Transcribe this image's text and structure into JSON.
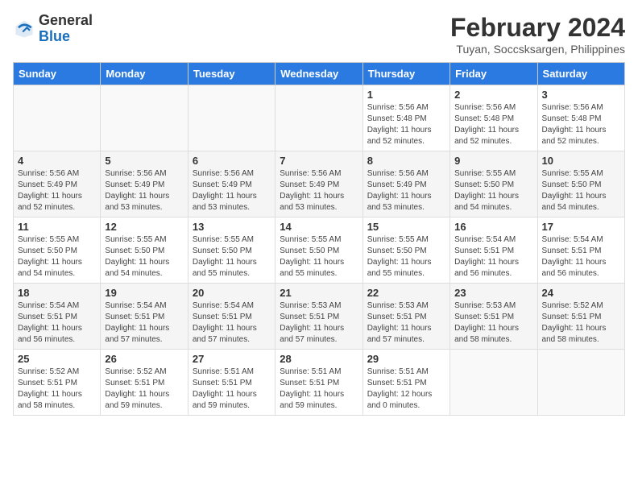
{
  "header": {
    "logo_line1": "General",
    "logo_line2": "Blue",
    "month_title": "February 2024",
    "subtitle": "Tuyan, Soccsksargen, Philippines"
  },
  "weekdays": [
    "Sunday",
    "Monday",
    "Tuesday",
    "Wednesday",
    "Thursday",
    "Friday",
    "Saturday"
  ],
  "weeks": [
    [
      {
        "day": "",
        "sunrise": "",
        "sunset": "",
        "daylight": ""
      },
      {
        "day": "",
        "sunrise": "",
        "sunset": "",
        "daylight": ""
      },
      {
        "day": "",
        "sunrise": "",
        "sunset": "",
        "daylight": ""
      },
      {
        "day": "",
        "sunrise": "",
        "sunset": "",
        "daylight": ""
      },
      {
        "day": "1",
        "sunrise": "5:56 AM",
        "sunset": "5:48 PM",
        "daylight": "11 hours and 52 minutes."
      },
      {
        "day": "2",
        "sunrise": "5:56 AM",
        "sunset": "5:48 PM",
        "daylight": "11 hours and 52 minutes."
      },
      {
        "day": "3",
        "sunrise": "5:56 AM",
        "sunset": "5:48 PM",
        "daylight": "11 hours and 52 minutes."
      }
    ],
    [
      {
        "day": "4",
        "sunrise": "5:56 AM",
        "sunset": "5:49 PM",
        "daylight": "11 hours and 52 minutes."
      },
      {
        "day": "5",
        "sunrise": "5:56 AM",
        "sunset": "5:49 PM",
        "daylight": "11 hours and 53 minutes."
      },
      {
        "day": "6",
        "sunrise": "5:56 AM",
        "sunset": "5:49 PM",
        "daylight": "11 hours and 53 minutes."
      },
      {
        "day": "7",
        "sunrise": "5:56 AM",
        "sunset": "5:49 PM",
        "daylight": "11 hours and 53 minutes."
      },
      {
        "day": "8",
        "sunrise": "5:56 AM",
        "sunset": "5:49 PM",
        "daylight": "11 hours and 53 minutes."
      },
      {
        "day": "9",
        "sunrise": "5:55 AM",
        "sunset": "5:50 PM",
        "daylight": "11 hours and 54 minutes."
      },
      {
        "day": "10",
        "sunrise": "5:55 AM",
        "sunset": "5:50 PM",
        "daylight": "11 hours and 54 minutes."
      }
    ],
    [
      {
        "day": "11",
        "sunrise": "5:55 AM",
        "sunset": "5:50 PM",
        "daylight": "11 hours and 54 minutes."
      },
      {
        "day": "12",
        "sunrise": "5:55 AM",
        "sunset": "5:50 PM",
        "daylight": "11 hours and 54 minutes."
      },
      {
        "day": "13",
        "sunrise": "5:55 AM",
        "sunset": "5:50 PM",
        "daylight": "11 hours and 55 minutes."
      },
      {
        "day": "14",
        "sunrise": "5:55 AM",
        "sunset": "5:50 PM",
        "daylight": "11 hours and 55 minutes."
      },
      {
        "day": "15",
        "sunrise": "5:55 AM",
        "sunset": "5:50 PM",
        "daylight": "11 hours and 55 minutes."
      },
      {
        "day": "16",
        "sunrise": "5:54 AM",
        "sunset": "5:51 PM",
        "daylight": "11 hours and 56 minutes."
      },
      {
        "day": "17",
        "sunrise": "5:54 AM",
        "sunset": "5:51 PM",
        "daylight": "11 hours and 56 minutes."
      }
    ],
    [
      {
        "day": "18",
        "sunrise": "5:54 AM",
        "sunset": "5:51 PM",
        "daylight": "11 hours and 56 minutes."
      },
      {
        "day": "19",
        "sunrise": "5:54 AM",
        "sunset": "5:51 PM",
        "daylight": "11 hours and 57 minutes."
      },
      {
        "day": "20",
        "sunrise": "5:54 AM",
        "sunset": "5:51 PM",
        "daylight": "11 hours and 57 minutes."
      },
      {
        "day": "21",
        "sunrise": "5:53 AM",
        "sunset": "5:51 PM",
        "daylight": "11 hours and 57 minutes."
      },
      {
        "day": "22",
        "sunrise": "5:53 AM",
        "sunset": "5:51 PM",
        "daylight": "11 hours and 57 minutes."
      },
      {
        "day": "23",
        "sunrise": "5:53 AM",
        "sunset": "5:51 PM",
        "daylight": "11 hours and 58 minutes."
      },
      {
        "day": "24",
        "sunrise": "5:52 AM",
        "sunset": "5:51 PM",
        "daylight": "11 hours and 58 minutes."
      }
    ],
    [
      {
        "day": "25",
        "sunrise": "5:52 AM",
        "sunset": "5:51 PM",
        "daylight": "11 hours and 58 minutes."
      },
      {
        "day": "26",
        "sunrise": "5:52 AM",
        "sunset": "5:51 PM",
        "daylight": "11 hours and 59 minutes."
      },
      {
        "day": "27",
        "sunrise": "5:51 AM",
        "sunset": "5:51 PM",
        "daylight": "11 hours and 59 minutes."
      },
      {
        "day": "28",
        "sunrise": "5:51 AM",
        "sunset": "5:51 PM",
        "daylight": "11 hours and 59 minutes."
      },
      {
        "day": "29",
        "sunrise": "5:51 AM",
        "sunset": "5:51 PM",
        "daylight": "12 hours and 0 minutes."
      },
      {
        "day": "",
        "sunrise": "",
        "sunset": "",
        "daylight": ""
      },
      {
        "day": "",
        "sunrise": "",
        "sunset": "",
        "daylight": ""
      }
    ]
  ]
}
